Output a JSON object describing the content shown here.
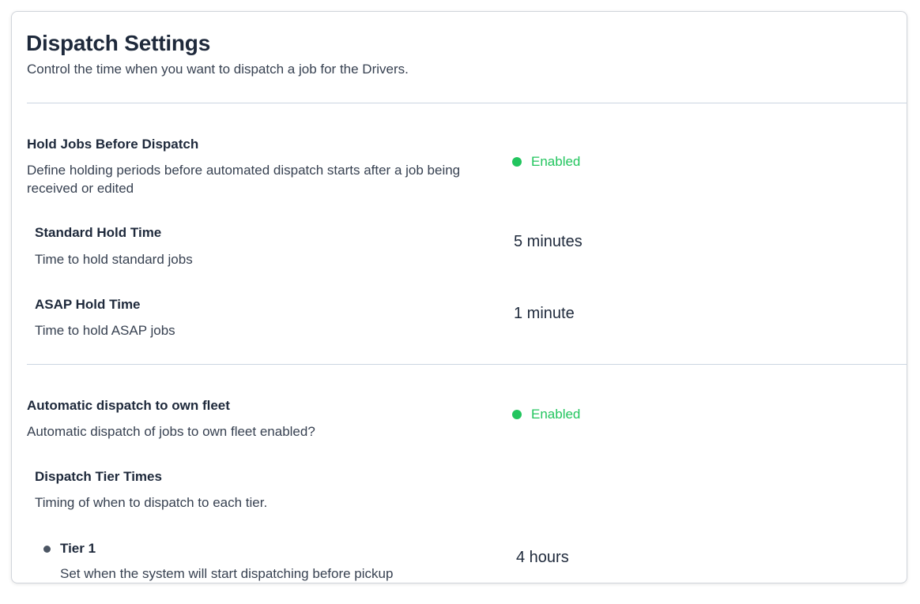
{
  "header": {
    "title": "Dispatch Settings",
    "subtitle": "Control the time when you want to dispatch a job for the Drivers."
  },
  "hold_jobs": {
    "label": "Hold Jobs Before Dispatch",
    "description": "Define holding periods before automated dispatch starts after a job being received or edited",
    "status": "Enabled",
    "standard": {
      "label": "Standard Hold Time",
      "description": "Time to hold standard jobs",
      "value": "5 minutes"
    },
    "asap": {
      "label": "ASAP Hold Time",
      "description": "Time to hold ASAP jobs",
      "value": "1 minute"
    }
  },
  "auto_dispatch": {
    "label": "Automatic dispatch to own fleet",
    "description": "Automatic dispatch of jobs to own fleet enabled?",
    "status": "Enabled",
    "tier_times": {
      "label": "Dispatch Tier Times",
      "description": "Timing of when to dispatch to each tier.",
      "tiers": [
        {
          "label": "Tier 1",
          "description": "Set when the system will start dispatching before pickup",
          "value": "4 hours"
        }
      ]
    }
  },
  "colors": {
    "enabled": "#22c55e",
    "bullet": "#4b5563"
  }
}
